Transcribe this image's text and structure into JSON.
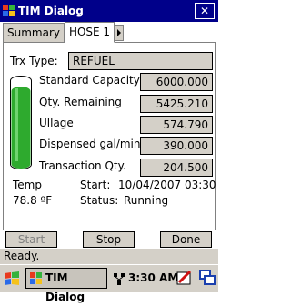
{
  "window": {
    "title": "TIM Dialog",
    "close_label": "✕"
  },
  "tabs": [
    {
      "label": "Summary"
    },
    {
      "label": "HOSE 1"
    }
  ],
  "form": {
    "trx_type_label": "Trx Type:",
    "trx_type_value": "REFUEL",
    "fields": [
      {
        "label": "Standard Capacity",
        "value": "6000.000"
      },
      {
        "label": "Qty. Remaining",
        "value": "5425.210"
      },
      {
        "label": "Ullage",
        "value": "574.790"
      },
      {
        "label": "Dispensed gal/min",
        "value": "390.000"
      },
      {
        "label": "Transaction Qty.",
        "value": "204.500"
      }
    ],
    "tank_fill_fraction": 0.9,
    "temp_label": "Temp",
    "temp_value": "78.8 ºF",
    "start_label": "Start:",
    "start_value": "10/04/2007 03:30",
    "status_label": "Status:",
    "status_value": "Running"
  },
  "buttons": {
    "start": "Start",
    "stop": "Stop",
    "done": "Done"
  },
  "statusbar": {
    "text": "Ready."
  },
  "taskbar": {
    "task_label": "TIM Dialog",
    "time": "3:30 AM"
  },
  "colors": {
    "titlebar": "#00008a",
    "tank_green": "#2eaa2e",
    "field_gray": "#d4d0c8"
  }
}
